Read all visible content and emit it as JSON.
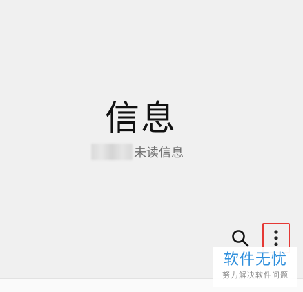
{
  "header": {
    "title": "信息",
    "unread_suffix": "未读信息"
  },
  "toolbar": {
    "search_icon": "search-icon",
    "more_icon": "more-vert-icon",
    "highlight_color": "#e53935"
  },
  "watermark": {
    "main": "软件无忧",
    "sub": "努力解决软件问题",
    "color": "#2f8fdc"
  }
}
